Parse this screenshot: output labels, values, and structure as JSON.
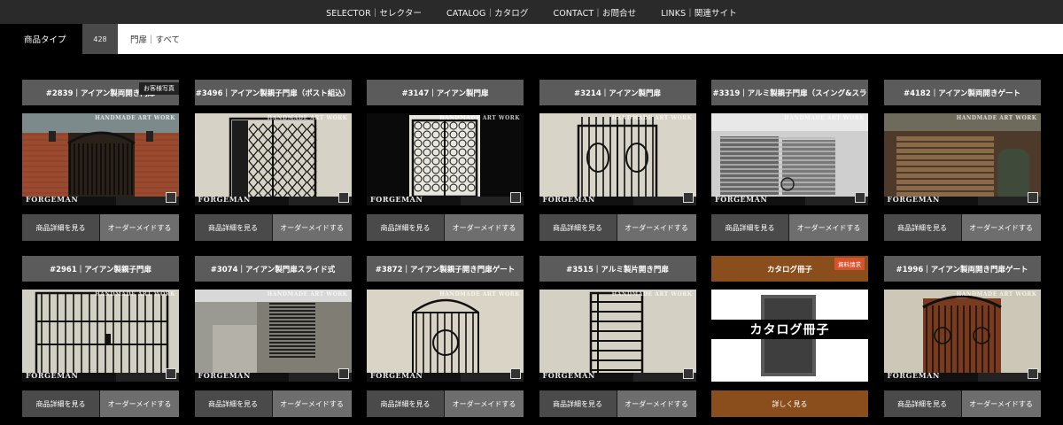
{
  "nav": {
    "links": [
      "SELECTOR｜セレクター",
      "CATALOG｜カタログ",
      "CONTACT｜お問合せ",
      "LINKS｜関連サイト"
    ]
  },
  "filter": {
    "label": "商品タイプ",
    "count": "428",
    "current": "門扉｜すべて"
  },
  "buttons": {
    "detail": "商品詳細を見る",
    "order": "オーダーメイドする",
    "more": "詳しく見る"
  },
  "watermark": {
    "top": "HANDMADE ART WORK",
    "bottom": "FORGEMAN"
  },
  "products": [
    {
      "title": "#2839｜アイアン製両開き門扉",
      "badge": "お客様写真",
      "scene": "brick"
    },
    {
      "title": "#3496｜アイアン製親子門扉（ポスト組込）",
      "scene": "lattice"
    },
    {
      "title": "#3147｜アイアン製門扉",
      "scene": "framed"
    },
    {
      "title": "#3214｜アイアン製門扉",
      "scene": "ornate"
    },
    {
      "title": "#3319｜アルミ製親子門扉（スイング&スラ",
      "scene": "slats"
    },
    {
      "title": "#4182｜アイアン製両開きゲート",
      "scene": "wood"
    },
    {
      "title": "#2961｜アイアン製親子門扉",
      "scene": "bars"
    },
    {
      "title": "#3074｜アイアン製門扉スライド式",
      "scene": "slide"
    },
    {
      "title": "#3872｜アイアン製親子開き門扉ゲート",
      "scene": "arch"
    },
    {
      "title": "#3515｜アルミ製片開き門扉",
      "scene": "ladder"
    },
    {
      "title": "カタログ冊子",
      "badge": "資料請求",
      "scene": "catalog",
      "banner": "カタログ冊子"
    },
    {
      "title": "#1996｜アイアン製両開き門扉ゲート",
      "scene": "wooddoor"
    }
  ],
  "colors": {
    "topnav": "#2a2a2a",
    "title_bar": "#5b5b5b",
    "catalog_accent": "#8a4d1c",
    "badge_red": "#d9522a"
  }
}
